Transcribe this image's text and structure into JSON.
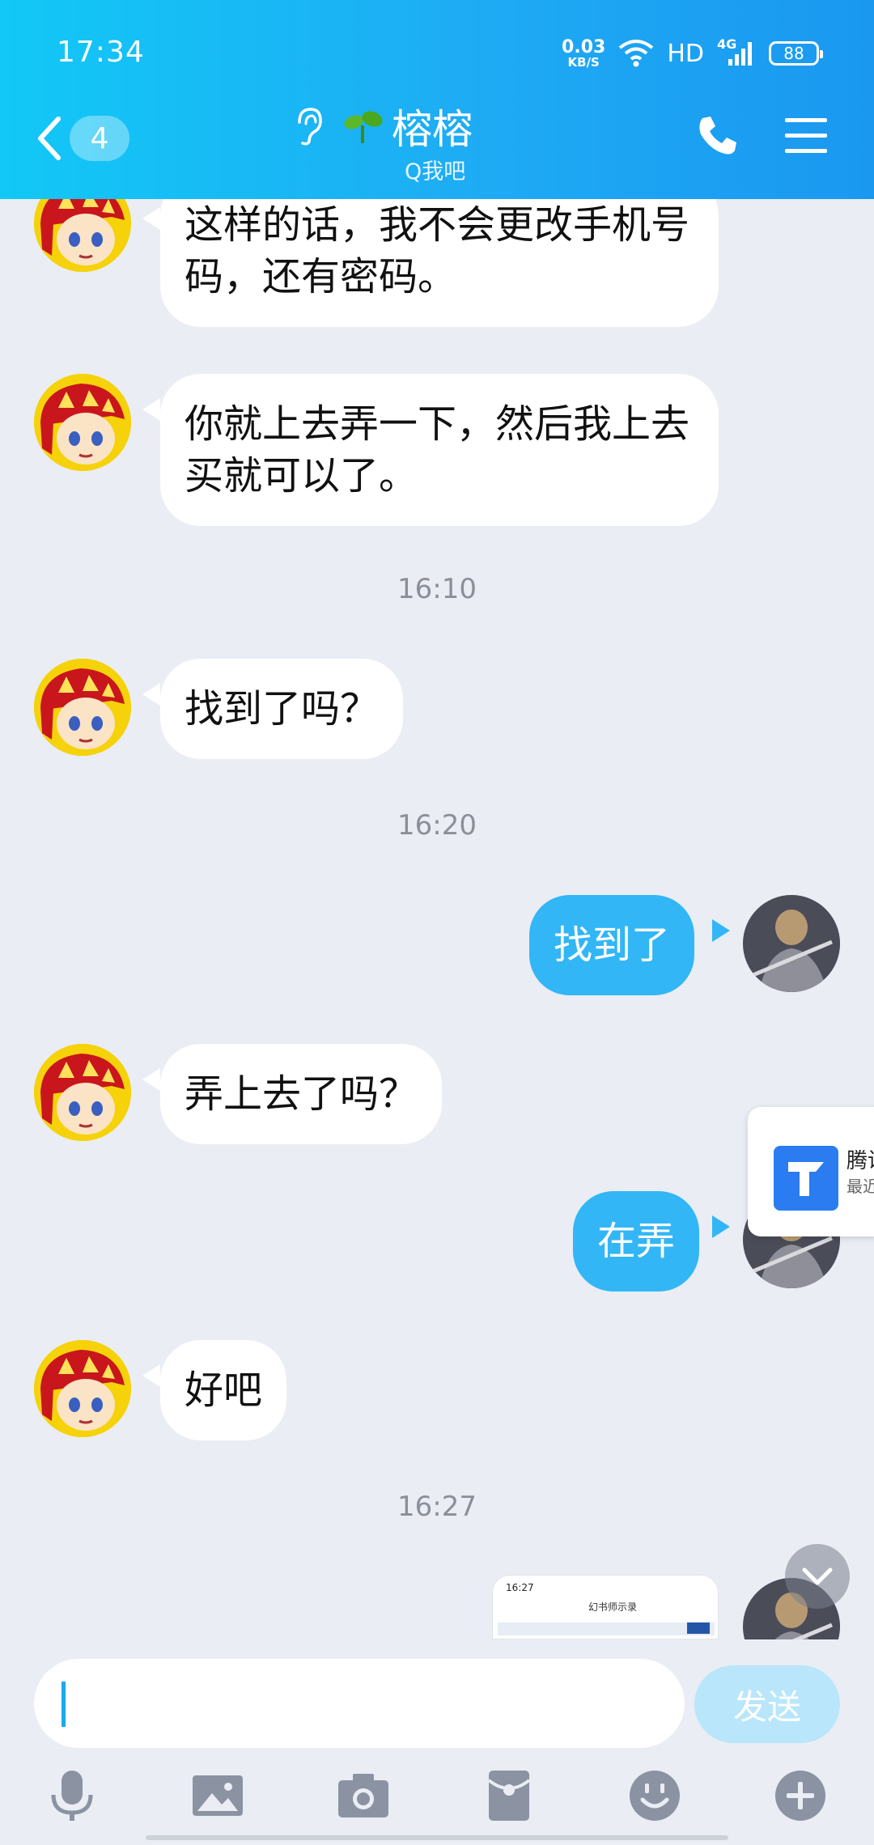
{
  "status_bar": {
    "time": "17:34",
    "net_speed_value": "0.03",
    "net_speed_unit": "KB/S",
    "hd_label": "HD",
    "network_label": "4G",
    "battery": "88"
  },
  "header": {
    "back_badge": "4",
    "title": "榕榕",
    "subtitle": "Q我吧",
    "colors": {
      "gradient_start": "#12c8f6",
      "gradient_end": "#1a98f0"
    }
  },
  "messages": [
    {
      "side": "left",
      "text": "这样的话，我不会更改手机号码，还有密码。"
    },
    {
      "side": "left",
      "text": "你就上去弄一下，然后我上去买就可以了。"
    },
    {
      "type": "timestamp",
      "text": "16:10"
    },
    {
      "side": "left",
      "text": "找到了吗？"
    },
    {
      "type": "timestamp",
      "text": "16:20"
    },
    {
      "side": "right",
      "text": "找到了"
    },
    {
      "side": "left",
      "text": "弄上去了吗？"
    },
    {
      "side": "right",
      "text": "在弄"
    },
    {
      "side": "left",
      "text": "好吧"
    },
    {
      "type": "timestamp",
      "text": "16:27"
    },
    {
      "side": "right",
      "type": "image",
      "preview_time": "16:27",
      "preview_title": "幻书师示录"
    }
  ],
  "floating_card": {
    "name": "腾讯",
    "sub": "最近"
  },
  "input": {
    "value": "",
    "send_label": "发送"
  },
  "toolbar": {
    "icons": [
      "microphone-icon",
      "image-icon",
      "camera-icon",
      "red-packet-icon",
      "emoji-icon",
      "plus-icon"
    ]
  },
  "colors": {
    "bubble_self": "#32b6f6",
    "bubble_other": "#ffffff",
    "background": "#eaedf4"
  }
}
